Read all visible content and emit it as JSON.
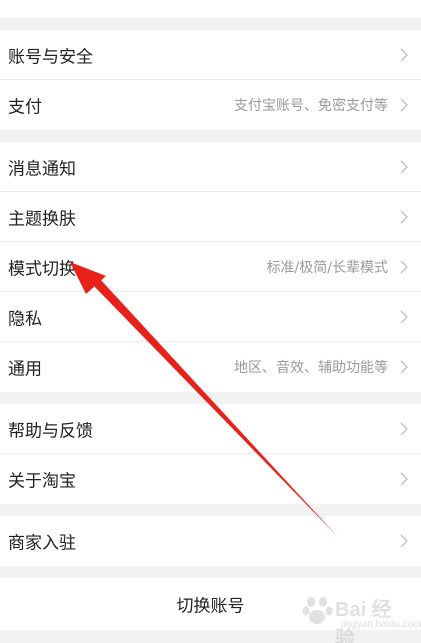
{
  "rows": [
    {
      "label": "账号与安全",
      "sub": ""
    },
    {
      "label": "支付",
      "sub": "支付宝账号、免密支付等"
    },
    {
      "label": "消息通知",
      "sub": ""
    },
    {
      "label": "主题换肤",
      "sub": ""
    },
    {
      "label": "模式切换",
      "sub": "标准/极简/长辈模式"
    },
    {
      "label": "隐私",
      "sub": ""
    },
    {
      "label": "通用",
      "sub": "地区、音效、辅助功能等"
    },
    {
      "label": "帮助与反馈",
      "sub": ""
    },
    {
      "label": "关于淘宝",
      "sub": ""
    },
    {
      "label": "商家入驻",
      "sub": ""
    }
  ],
  "switch_account_label": "切换账号",
  "annotation": {
    "color": "#e8221b"
  },
  "watermark": {
    "text": "Bai 经验",
    "url": "jingyan.baidu.com"
  }
}
